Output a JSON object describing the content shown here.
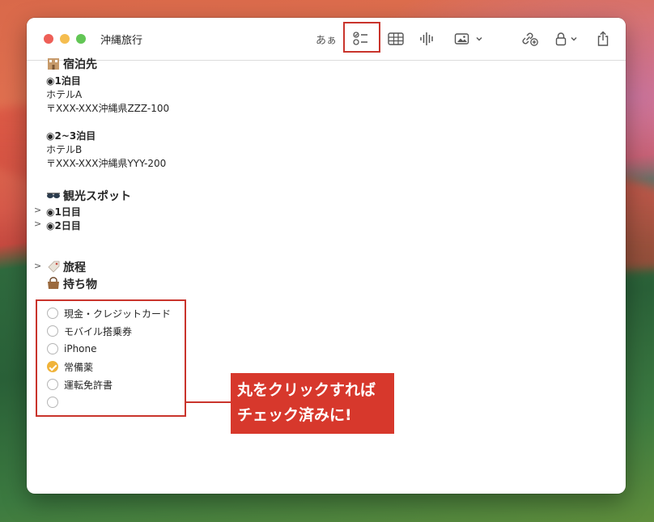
{
  "window": {
    "title": "沖縄旅行"
  },
  "toolbar": {
    "font_label": "あぁ",
    "icons": [
      "checklist-icon",
      "table-icon",
      "audio-icon",
      "media-icon",
      "collaborate-icon",
      "lock-icon",
      "share-icon"
    ]
  },
  "note": {
    "lodging_heading": "宿泊先",
    "night1_label": "◉1泊目",
    "hotel_a": "ホテルA",
    "address_a": "〒XXX-XXX沖縄県ZZZ-100",
    "night23_label": "◉2~3泊目",
    "hotel_b": "ホテルB",
    "address_b": "〒XXX-XXX沖縄県YYY-200",
    "sightseeing_heading": "観光スポット",
    "day1_label": "◉1日目",
    "day2_label": "◉2日目",
    "itinerary_heading": "旅程",
    "belongings_heading": "持ち物"
  },
  "checklist": [
    {
      "label": "現金・クレジットカード",
      "checked": false
    },
    {
      "label": "モバイル搭乗券",
      "checked": false
    },
    {
      "label": "iPhone",
      "checked": false
    },
    {
      "label": "常備薬",
      "checked": true
    },
    {
      "label": "運転免許書",
      "checked": false
    },
    {
      "label": "",
      "checked": false
    }
  ],
  "callout": {
    "line1": "丸をクリックすれば",
    "line2": "チェック済みに!"
  },
  "colors": {
    "accent_red": "#d7382c",
    "check_yellow": "#f0b33a"
  }
}
